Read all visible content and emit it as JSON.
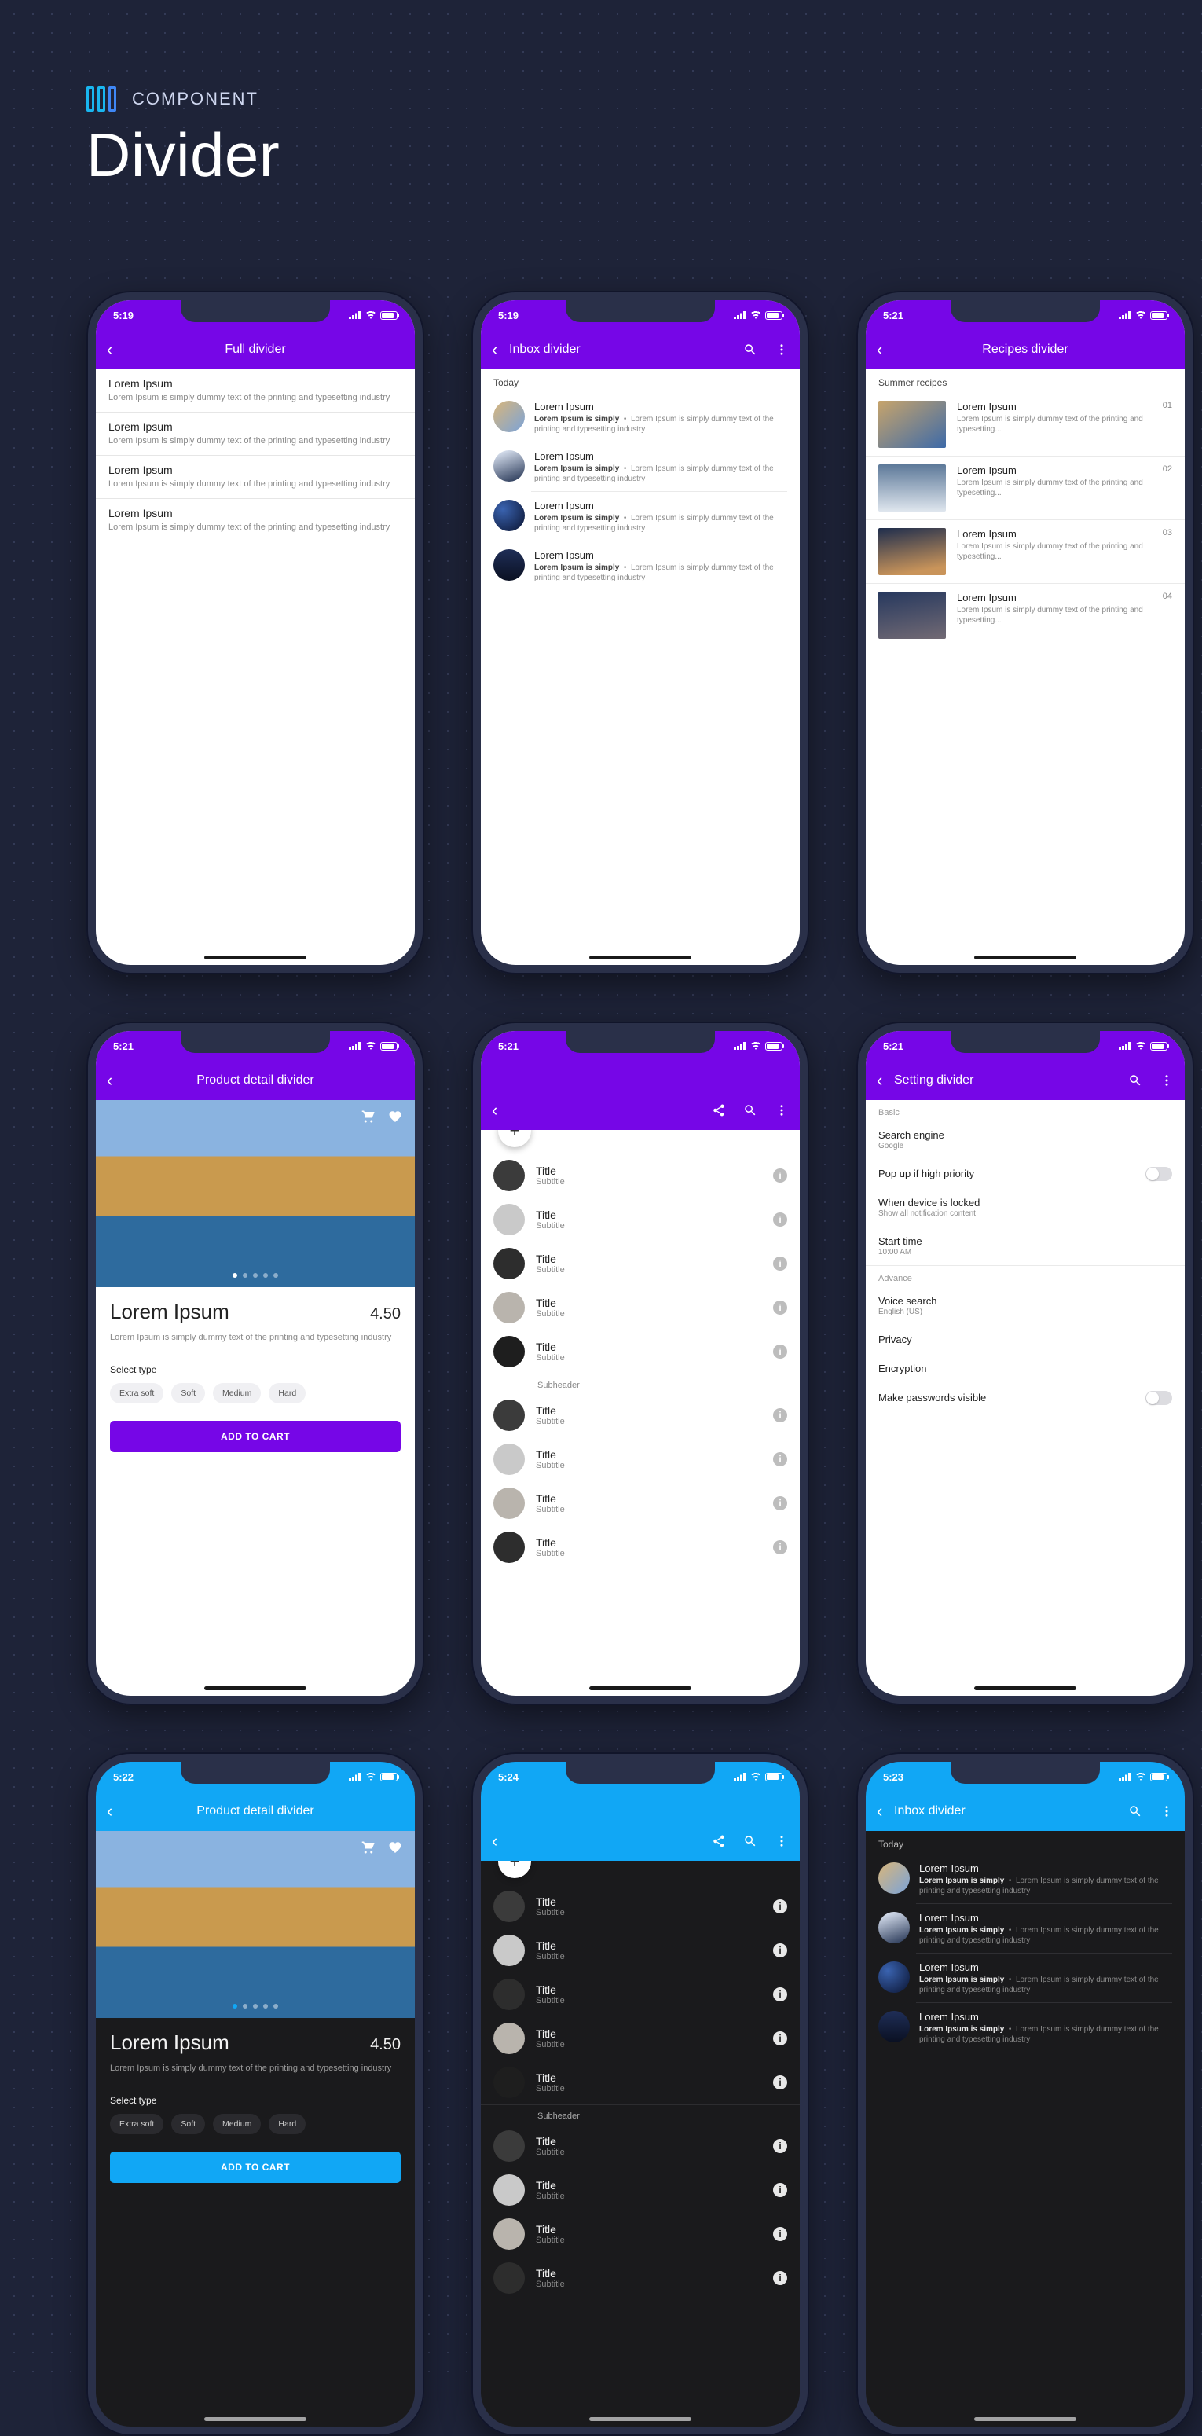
{
  "page_label": "COMPONENT",
  "page_title": "Divider",
  "lorem_title": "Lorem Ipsum",
  "lorem_body": "Lorem Ipsum is simply dummy text of the printing and typesetting industry",
  "lorem_bold": "Lorem Ipsum is simply",
  "lorem_tail": "Lorem Ipsum is simply dummy text of the printing and typesetting industry",
  "phones": {
    "p1": {
      "time": "5:19",
      "title": "Full divider"
    },
    "p2": {
      "time": "5:19",
      "title": "Inbox divider",
      "section": "Today"
    },
    "p3": {
      "time": "5:21",
      "title": "Recipes divider",
      "section": "Summer recipes",
      "nums": [
        "01",
        "02",
        "03",
        "04"
      ]
    },
    "p4": {
      "time": "5:21",
      "title": "Product detail divider",
      "name": "Lorem Ipsum",
      "price": "4.50",
      "sel": "Select type",
      "chips": [
        "Extra soft",
        "Soft",
        "Medium",
        "Hard"
      ],
      "btn": "ADD TO CART"
    },
    "p5": {
      "time": "5:21",
      "item": {
        "t": "Title",
        "s": "Subtitle"
      },
      "sub": "Subheader"
    },
    "p6": {
      "time": "5:21",
      "title": "Setting divider",
      "g1": "Basic",
      "g2": "Advance",
      "r1": {
        "t": "Search engine",
        "s": "Google"
      },
      "r2": {
        "t": "Pop up if high priority"
      },
      "r3": {
        "t": "When device is locked",
        "s": "Show all notification content"
      },
      "r4": {
        "t": "Start time",
        "s": "10:00 AM"
      },
      "r5": {
        "t": "Voice search",
        "s": "English (US)"
      },
      "r6": {
        "t": "Privacy"
      },
      "r7": {
        "t": "Encryption"
      },
      "r8": {
        "t": "Make passwords visible"
      }
    },
    "p7": {
      "time": "5:22",
      "title": "Product detail divider",
      "name": "Lorem Ipsum",
      "price": "4.50",
      "sel": "Select type",
      "chips": [
        "Extra soft",
        "Soft",
        "Medium",
        "Hard"
      ],
      "btn": "ADD TO CART"
    },
    "p8": {
      "time": "5:24",
      "item": {
        "t": "Title",
        "s": "Subtitle"
      },
      "sub": "Subheader"
    },
    "p9": {
      "time": "5:23",
      "title": "Inbox divider",
      "section": "Today"
    }
  }
}
